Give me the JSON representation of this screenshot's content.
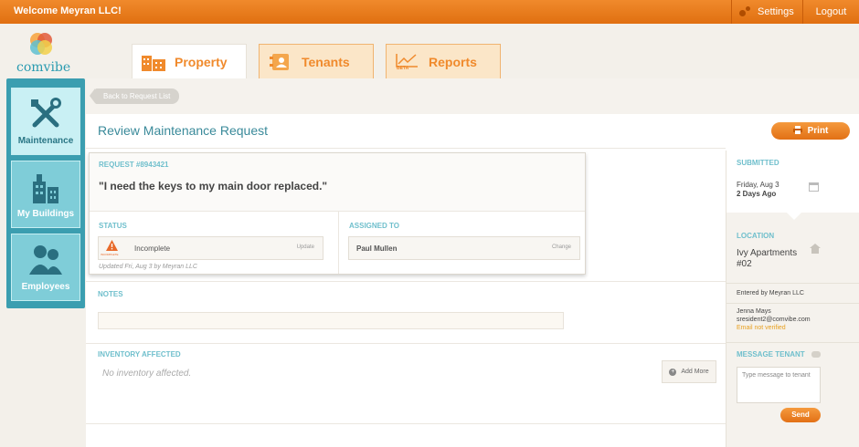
{
  "header": {
    "welcome": "Welcome Meyran LLC!",
    "settings_label": "Settings",
    "logout_label": "Logout"
  },
  "logo": {
    "text": "comvibe"
  },
  "tabs": [
    {
      "label": "Property",
      "icon": "building-icon",
      "active": true
    },
    {
      "label": "Tenants",
      "icon": "contacts-icon",
      "active": false
    },
    {
      "label": "Reports",
      "icon": "chart-beta-icon",
      "active": false,
      "badge": "BETA"
    }
  ],
  "sidebar": {
    "items": [
      {
        "label": "Maintenance",
        "icon": "tools-icon",
        "active": true
      },
      {
        "label": "My Buildings",
        "icon": "buildings-icon",
        "active": false
      },
      {
        "label": "Employees",
        "icon": "people-icon",
        "active": false
      }
    ]
  },
  "breadcrumb": {
    "back_label": "Back to Request List"
  },
  "page": {
    "title": "Review Maintenance Request",
    "print_label": "Print"
  },
  "request": {
    "number_label": "REQUEST #8943421",
    "quote": "\"I need the keys to my main door replaced.\"",
    "status_label": "STATUS",
    "status_value": "Incomplete",
    "status_icon_caption": "INCOMPLETE",
    "status_action": "Update",
    "updated_text": "Updated Fri, Aug 3 by Meyran LLC",
    "assigned_label": "ASSIGNED TO",
    "assigned_value": "Paul Mullen",
    "assigned_action": "Change"
  },
  "notes": {
    "label": "NOTES",
    "value": ""
  },
  "inventory": {
    "label": "INVENTORY AFFECTED",
    "empty_text": "No inventory affected.",
    "add_label": "Add More"
  },
  "submitted": {
    "label": "SUBMITTED",
    "date": "Friday, Aug 3",
    "ago": "2 Days Ago"
  },
  "location": {
    "label": "LOCATION",
    "line1": "Ivy Apartments",
    "line2": "#02",
    "entered_by": "Entered by Meyran LLC"
  },
  "tenant": {
    "name": "Jenna Mays",
    "email": "sresident2@comvibe.com",
    "email_status": "Email not verified"
  },
  "message": {
    "label": "MESSAGE TENANT",
    "placeholder": "Type message to tenant",
    "send_label": "Send"
  },
  "colors": {
    "accent": "#f08a2c",
    "teal": "#3b9eb0",
    "title": "#3a8a9a",
    "warning": "#e8a020"
  }
}
